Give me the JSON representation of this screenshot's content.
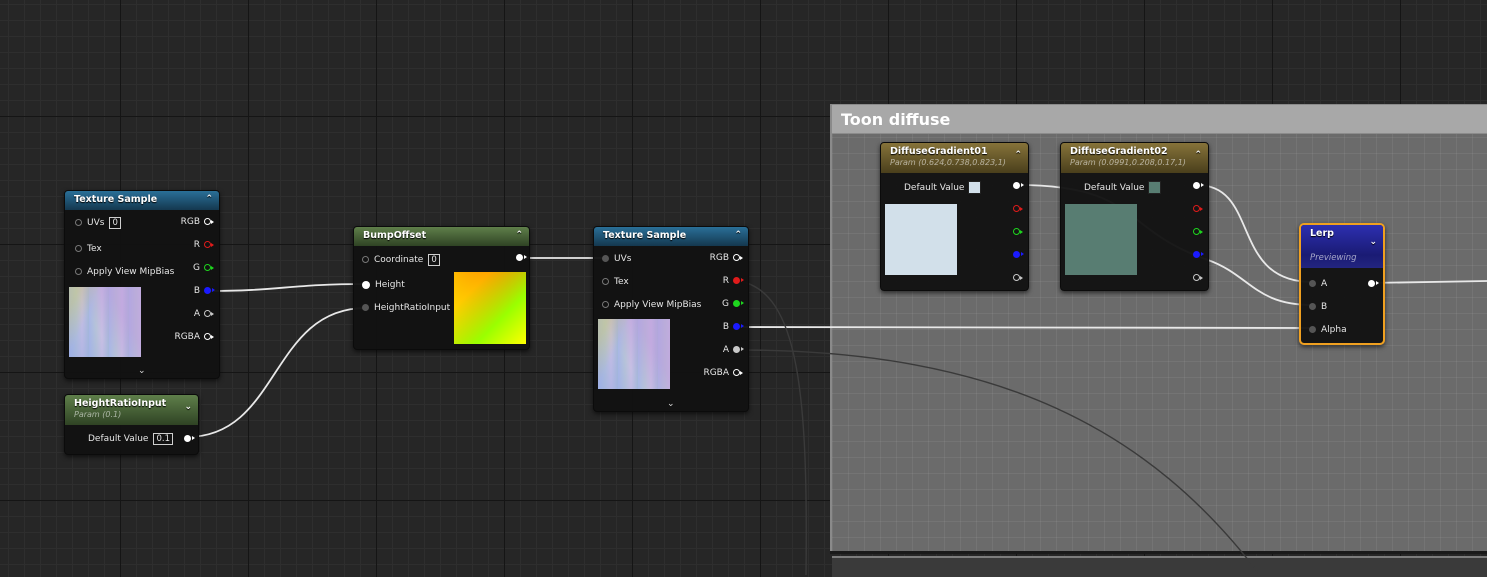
{
  "comment": {
    "title": "Toon diffuse"
  },
  "nodes": {
    "texture_sample_1": {
      "title": "Texture Sample",
      "inputs": [
        "UVs",
        "Tex",
        "Apply View MipBias"
      ],
      "uvs_value": "0",
      "outputs": [
        "RGB",
        "R",
        "G",
        "B",
        "A",
        "RGBA"
      ]
    },
    "height_ratio_input": {
      "title": "HeightRatioInput",
      "subtitle": "Param (0.1)",
      "default_label": "Default Value",
      "default_value": "0.1"
    },
    "bump_offset": {
      "title": "BumpOffset",
      "inputs": [
        "Coordinate",
        "Height",
        "HeightRatioInput"
      ],
      "coordinate_value": "0"
    },
    "texture_sample_2": {
      "title": "Texture Sample",
      "inputs": [
        "UVs",
        "Tex",
        "Apply View MipBias"
      ],
      "outputs": [
        "RGB",
        "R",
        "G",
        "B",
        "A",
        "RGBA"
      ]
    },
    "diffuse_gradient_01": {
      "title": "DiffuseGradient01",
      "subtitle": "Param (0.624,0.738,0.823,1)",
      "default_label": "Default Value",
      "color": "#d2e0ea"
    },
    "diffuse_gradient_02": {
      "title": "DiffuseGradient02",
      "subtitle": "Param (0.0991,0.208,0.17,1)",
      "default_label": "Default Value",
      "color": "#587d72"
    },
    "lerp": {
      "title": "Lerp",
      "status": "Previewing",
      "inputs": [
        "A",
        "B",
        "Alpha"
      ]
    }
  },
  "pin_colors": {
    "white": "#ffffff",
    "red": "#e01b1b",
    "green": "#1ed61e",
    "blue": "#1a1aff",
    "grey": "#c8c8c8"
  }
}
